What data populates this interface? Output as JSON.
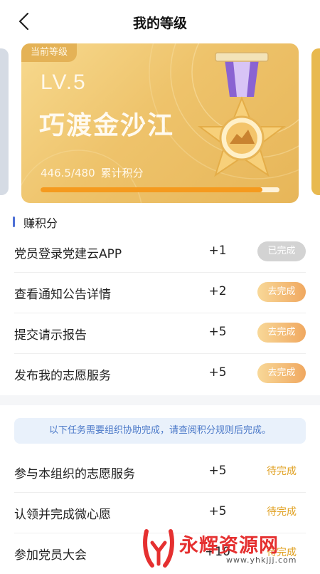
{
  "header": {
    "title": "我的等级"
  },
  "level_card": {
    "badge": "当前等级",
    "level_code": "LV.5",
    "level_name": "巧渡金沙江",
    "points_value": "446.5/480",
    "points_label": "累计积分",
    "progress_fraction": 0.93
  },
  "earn_section": {
    "title": "赚积分",
    "tasks": [
      {
        "name": "党员登录党建云APP",
        "points": "+1",
        "action": "已完成",
        "state": "done"
      },
      {
        "name": "查看通知公告详情",
        "points": "+2",
        "action": "去完成",
        "state": "todo"
      },
      {
        "name": "提交请示报告",
        "points": "+5",
        "action": "去完成",
        "state": "todo"
      },
      {
        "name": "发布我的志愿服务",
        "points": "+5",
        "action": "去完成",
        "state": "todo"
      }
    ]
  },
  "org_section": {
    "notice": "以下任务需要组织协助完成，请查阅积分规则后完成。",
    "tasks": [
      {
        "name": "参与本组织的志愿服务",
        "points": "+5",
        "status": "待完成"
      },
      {
        "name": "认领并完成微心愿",
        "points": "+5",
        "status": "待完成"
      },
      {
        "name": "参加党员大会",
        "points": "+10",
        "status": "待完成"
      }
    ]
  },
  "watermark": {
    "title": "永辉资源网",
    "url": "www.yhkjjj.com"
  },
  "colors": {
    "accent_blue": "#4d6fd6",
    "progress": "#f59a1e",
    "pending": "#e0a020"
  }
}
